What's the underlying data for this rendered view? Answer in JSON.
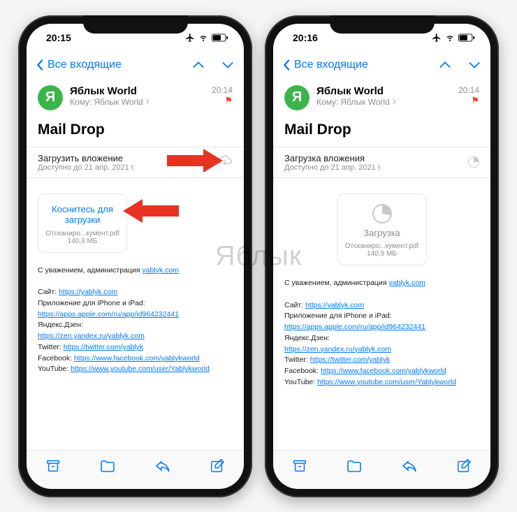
{
  "watermark": "Яблык",
  "phones": [
    {
      "status": {
        "time": "20:15"
      },
      "nav": {
        "back_label": "Все входящие"
      },
      "sender": {
        "avatar_letter": "Я",
        "name": "Яблык World",
        "to_prefix": "Кому:",
        "to_name": "Яблык World"
      },
      "meta": {
        "time": "20:14"
      },
      "subject": "Mail Drop",
      "maildrop": {
        "title": "Загрузить вложение",
        "sub": "Доступно до 21 апр. 2021 г.",
        "state": "download"
      },
      "attachment": {
        "state": "tap",
        "tap_label": "Коснитесь для загрузки",
        "filename": "Отсканиро...кумент.pdf",
        "size": "140,9 МБ"
      }
    },
    {
      "status": {
        "time": "20:16"
      },
      "nav": {
        "back_label": "Все входящие"
      },
      "sender": {
        "avatar_letter": "Я",
        "name": "Яблык World",
        "to_prefix": "Кому:",
        "to_name": "Яблык World"
      },
      "meta": {
        "time": "20:14"
      },
      "subject": "Mail Drop",
      "maildrop": {
        "title": "Загрузка вложения",
        "sub": "Доступно до 21 апр. 2021 г.",
        "state": "loading"
      },
      "attachment": {
        "state": "loading",
        "tap_label": "Загрузка",
        "filename": "Отсканиро...кумент.pdf",
        "size": "140,9 МБ"
      }
    }
  ],
  "body": {
    "greeting_prefix": "С уважением, администрация ",
    "greeting_link": "yablyk.com",
    "lines": [
      {
        "label": "Сайт:",
        "url": "https://yablyk.com"
      },
      {
        "label": "Приложение для iPhone и iPad:",
        "url": "https://apps.apple.com/ru/app/id964232441"
      },
      {
        "label": "Яндекс.Дзен:",
        "url": "https://zen.yandex.ru/yablyk.com"
      },
      {
        "label": "Twitter:",
        "url": "https://twitter.com/yablyk"
      },
      {
        "label": "Facebook:",
        "url": "https://www.facebook.com/yablykworld"
      },
      {
        "label": "YouTube:",
        "url": "https://www.youtube.com/user/Yablykworld"
      }
    ]
  }
}
